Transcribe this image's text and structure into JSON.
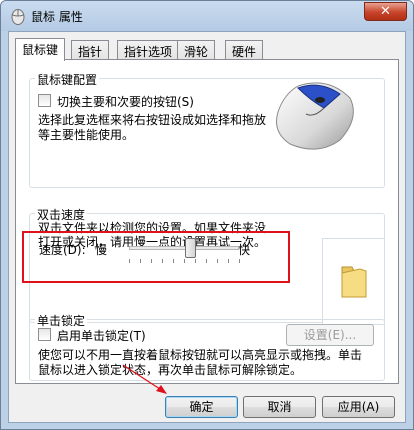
{
  "window": {
    "title": "鼠标 属性",
    "close_label": "✕"
  },
  "tabs": [
    {
      "label": "鼠标键"
    },
    {
      "label": "指针"
    },
    {
      "label": "指针选项"
    },
    {
      "label": "滑轮"
    },
    {
      "label": "硬件"
    }
  ],
  "button_config": {
    "title": "鼠标键配置",
    "switch_checkbox_label": "切换主要和次要的按钮(S)",
    "switch_checked": false,
    "description_line1": "选择此复选框来将右按钮设成如选择和拖放",
    "description_line2": "等主要性能使用。"
  },
  "double_click": {
    "title": "双击速度",
    "description_line1": "双击文件夹以检测您的设置。如果文件夹没",
    "description_line2": "打开或关闭，请用慢一点的设置再试一次。",
    "speed_label": "速度(D):",
    "slow_label": "慢",
    "fast_label": "快",
    "speed_level": 0.55
  },
  "click_lock": {
    "title": "单击锁定",
    "checkbox_label": "启用单击锁定(T)",
    "checked": false,
    "settings_button": "设置(E)...",
    "description_line1": "使您可以不用一直按着鼠标按钮就可以高亮显示或拖拽。单击",
    "description_line2": "鼠标以进入锁定状态，再次单击鼠标可解除锁定。"
  },
  "footer": {
    "ok": "确定",
    "cancel": "取消",
    "apply": "应用(A)"
  },
  "colors": {
    "highlight_border": "#e0101c",
    "annotation_arrow": "#e0101c"
  }
}
